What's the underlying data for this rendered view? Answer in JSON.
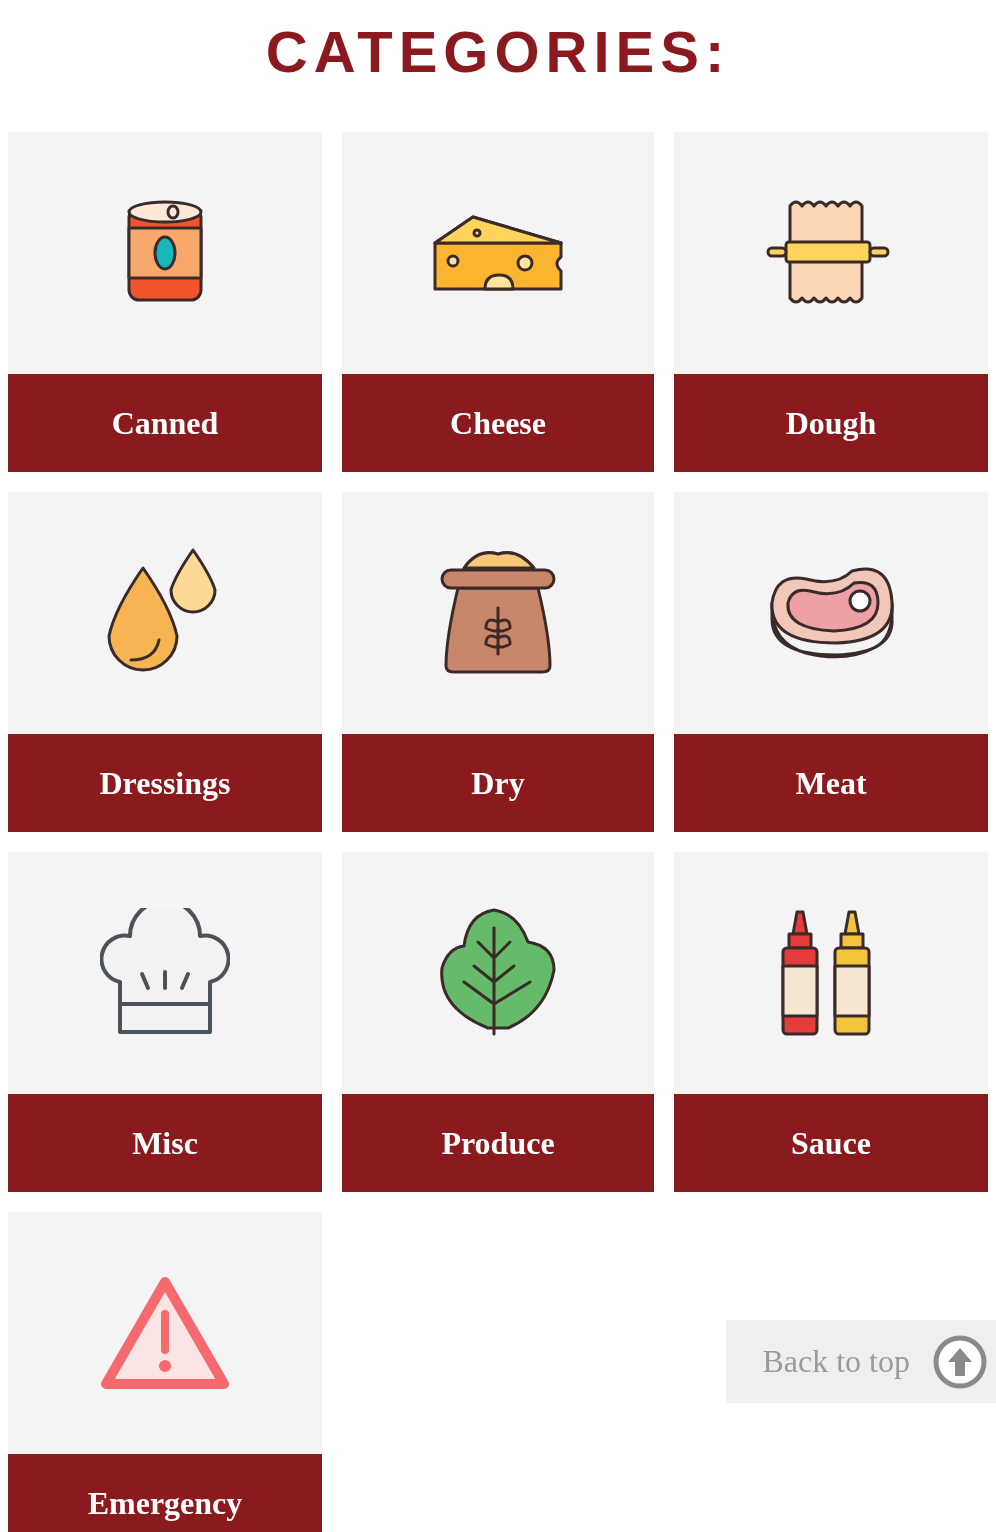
{
  "title": "CATEGORIES:",
  "categories": [
    {
      "label": "Canned"
    },
    {
      "label": "Cheese"
    },
    {
      "label": "Dough"
    },
    {
      "label": "Dressings"
    },
    {
      "label": "Dry"
    },
    {
      "label": "Meat"
    },
    {
      "label": "Misc"
    },
    {
      "label": "Produce"
    },
    {
      "label": "Sauce"
    },
    {
      "label": "Emergency"
    }
  ],
  "back_to_top": {
    "label": "Back to top"
  }
}
